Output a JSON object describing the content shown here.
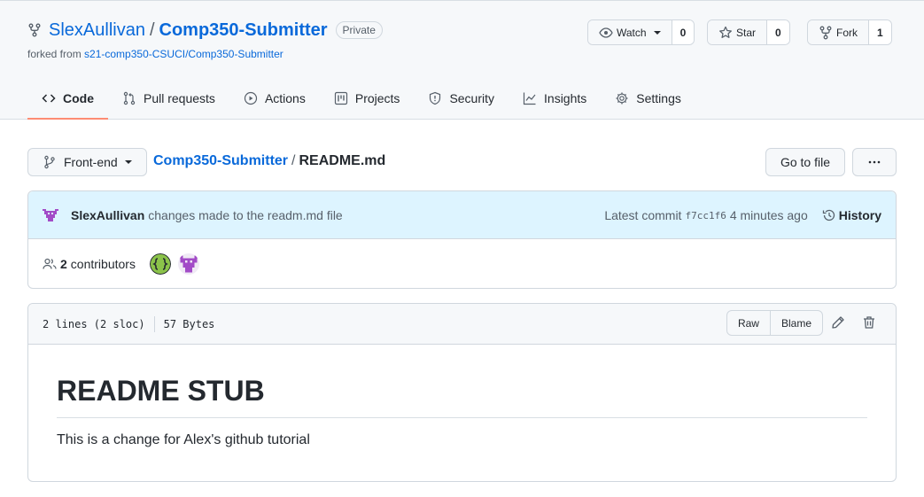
{
  "repo": {
    "owner": "SlexAullivan",
    "separator": "/",
    "name": "Comp350-Submitter",
    "visibility": "Private",
    "forked_prefix": "forked from ",
    "forked_from": "s21-comp350-CSUCI/Comp350-Submitter"
  },
  "social": {
    "watch_label": "Watch",
    "watch_count": "0",
    "star_label": "Star",
    "star_count": "0",
    "fork_label": "Fork",
    "fork_count": "1"
  },
  "tabs": [
    {
      "label": "Code",
      "icon": "code-icon",
      "active": true
    },
    {
      "label": "Pull requests",
      "icon": "pull-request-icon"
    },
    {
      "label": "Actions",
      "icon": "play-icon"
    },
    {
      "label": "Projects",
      "icon": "project-icon"
    },
    {
      "label": "Security",
      "icon": "shield-icon"
    },
    {
      "label": "Insights",
      "icon": "graph-icon"
    },
    {
      "label": "Settings",
      "icon": "gear-icon"
    }
  ],
  "breadcrumb": {
    "branch": "Front-end",
    "repo": "Comp350-Submitter",
    "separator": "/",
    "file": "README.md",
    "goto_label": "Go to file",
    "more_label": "···"
  },
  "commit": {
    "author": "SlexAullivan",
    "message": "changes made to the readm.md file",
    "latest_label": "Latest commit",
    "sha": "f7cc1f6",
    "time": "4 minutes ago",
    "history_label": "History"
  },
  "contributors": {
    "count": "2",
    "label": "contributors"
  },
  "file": {
    "lines": "2 lines (2 sloc)",
    "size": "57 Bytes",
    "raw_label": "Raw",
    "blame_label": "Blame"
  },
  "readme": {
    "heading": "README STUB",
    "body": "This is a change for Alex's github tutorial"
  },
  "colors": {
    "link": "#0969da",
    "active_tab_underline": "#fd8c73",
    "commit_bg": "#ddf4ff"
  }
}
